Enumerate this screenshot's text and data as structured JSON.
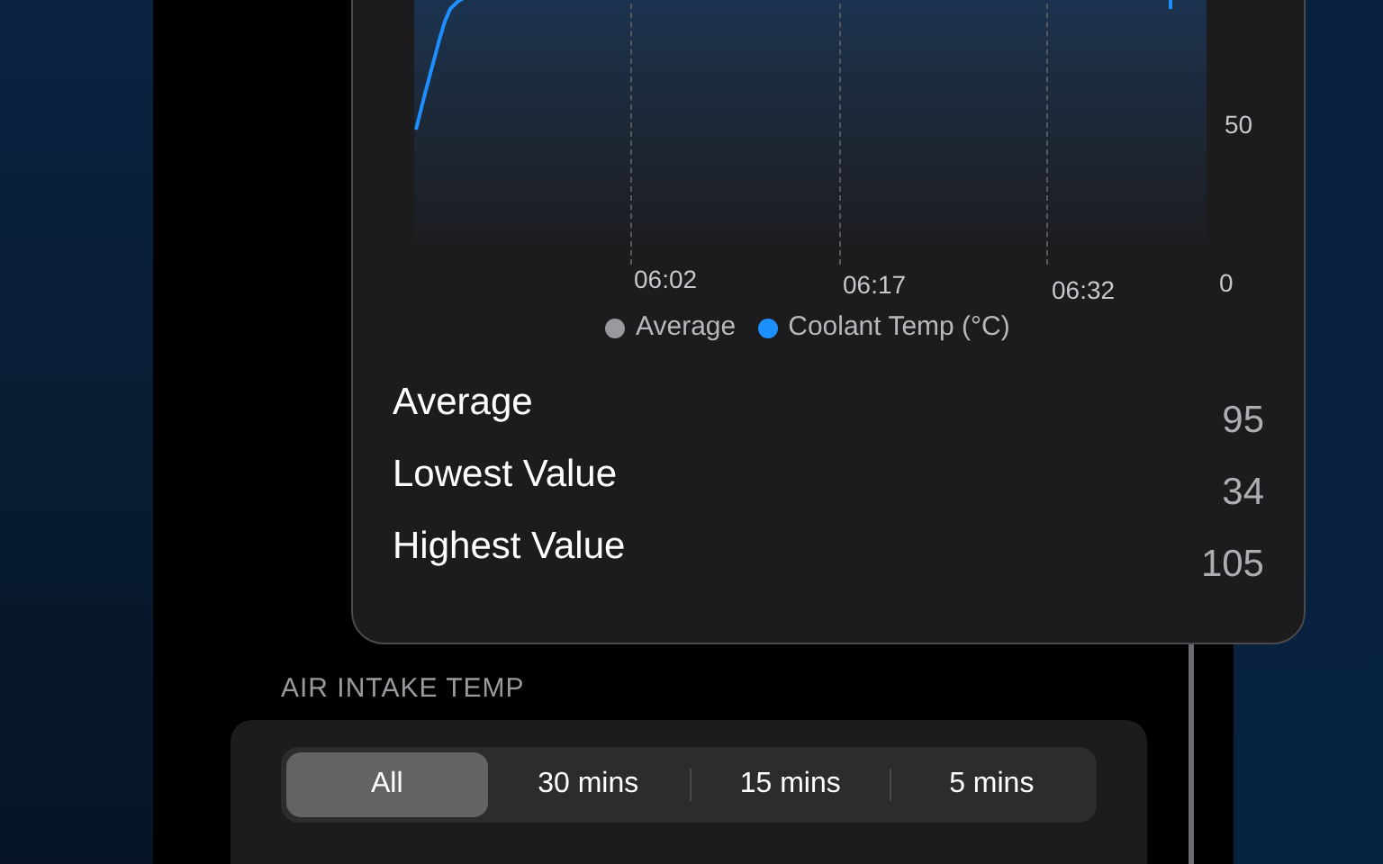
{
  "chart": {
    "y_ticks": [
      "50",
      "0"
    ],
    "x_ticks": [
      "06:02",
      "06:17",
      "06:32"
    ],
    "legend": [
      {
        "label": "Average",
        "color": "#9a9a9e"
      },
      {
        "label": "Coolant Temp (°C)",
        "color": "#1e8fff"
      }
    ]
  },
  "stats": [
    {
      "label": "Average",
      "value": "95"
    },
    {
      "label": "Lowest Value",
      "value": "34"
    },
    {
      "label": "Highest Value",
      "value": "105"
    }
  ],
  "section": {
    "title": "AIR INTAKE TEMP",
    "segments": [
      {
        "label": "All",
        "selected": true
      },
      {
        "label": "30 mins",
        "selected": false
      },
      {
        "label": "15 mins",
        "selected": false
      },
      {
        "label": "5 mins",
        "selected": false
      }
    ]
  }
}
